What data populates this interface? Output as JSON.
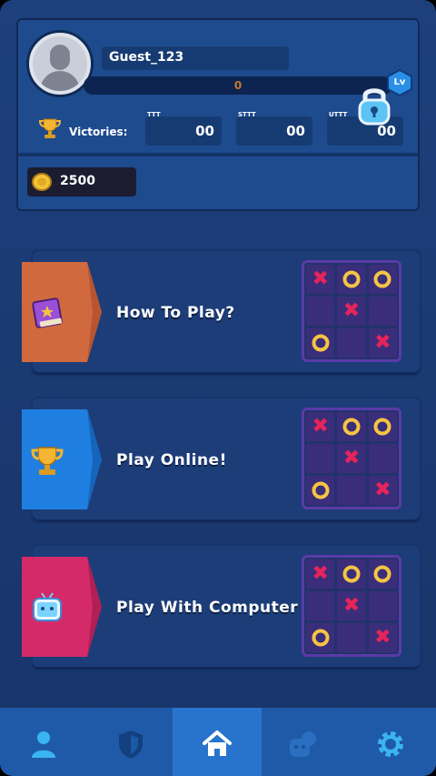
{
  "profile": {
    "username": "Guest_123",
    "xp_value": "0",
    "level_badge": "Lv",
    "victories_label": "Victories:",
    "stats": [
      {
        "tag": "TTT",
        "value": "00"
      },
      {
        "tag": "STTT",
        "value": "00"
      },
      {
        "tag": "UTTT",
        "value": "00"
      }
    ],
    "coins": "2500"
  },
  "modes": [
    {
      "title": "How To Play?",
      "icon": "rule-book-icon",
      "tab_color": "#d06a3e",
      "locked": true,
      "board": [
        "x",
        "o",
        "o",
        "",
        "x",
        "",
        "o",
        "",
        "x"
      ]
    },
    {
      "title": "Play Online!",
      "icon": "trophy-icon",
      "tab_color": "#1f7fe0",
      "locked": false,
      "board": [
        "x",
        "o",
        "o",
        "",
        "x",
        "",
        "o",
        "",
        "x"
      ]
    },
    {
      "title": "Play With Computer",
      "icon": "robot-tv-icon",
      "tab_color": "#d42a6a",
      "locked": false,
      "board": [
        "x",
        "o",
        "o",
        "",
        "x",
        "",
        "o",
        "",
        "x"
      ]
    }
  ],
  "nav": {
    "items": [
      "profile-icon",
      "shield-icon",
      "home-icon",
      "friends-icon",
      "settings-icon"
    ],
    "active": "home-icon"
  },
  "colors": {
    "x_mark": "#e6245a",
    "o_mark": "#f5c542",
    "board_bg": "#3a2e7a"
  }
}
